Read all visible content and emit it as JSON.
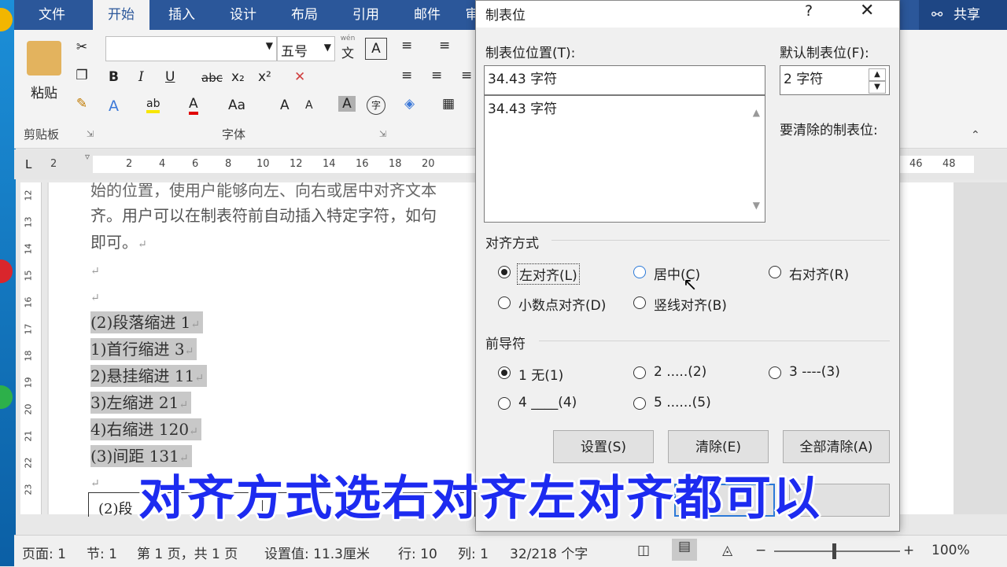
{
  "ribbon": {
    "tabs": [
      "文件",
      "开始",
      "插入",
      "设计",
      "布局",
      "引用",
      "邮件",
      "审"
    ],
    "active_tab": "开始",
    "share": "共享",
    "paste": "粘贴",
    "font_size": "五号",
    "clipboard_group": "剪贴板",
    "font_group": "字体",
    "wen": "wén",
    "wen_char": "文",
    "bold": "B",
    "italic": "I",
    "underline": "U",
    "strike": "abc",
    "subscript": "x₂",
    "superscript": "x²",
    "font_color": "A",
    "highlight": "ab",
    "change_case": "Aa",
    "grow": "A",
    "shrink": "A",
    "char_shade": "A",
    "enclose": "字"
  },
  "ruler": {
    "tab_selector": "L",
    "marks": [
      "2",
      "2",
      "4",
      "6",
      "8",
      "10",
      "12",
      "14",
      "16",
      "18",
      "20",
      "46",
      "48"
    ]
  },
  "vruler": [
    "12",
    "13",
    "14",
    "15",
    "16",
    "17",
    "18",
    "19",
    "20",
    "21",
    "22",
    "23"
  ],
  "document": {
    "line1": "始的位置，使用户能够向左、向右或居中对齐文本",
    "line2": "齐。用户可以在制表符前自动插入特定字符，如句",
    "line3": "即可。",
    "items": [
      "(2)段落缩进 1",
      "1)首行缩进 3",
      "2)悬挂缩进 11",
      "3)左缩进 21",
      "4)右缩进 120",
      "(3)间距 131"
    ],
    "table_cell": "(2)段"
  },
  "status": {
    "page": "页面: 1",
    "section": "节: 1",
    "pages": "第 1 页，共 1 页",
    "setting": "设置值: 11.3厘米",
    "row": "行: 10",
    "col": "列: 1",
    "words": "32/218 个字",
    "zoom": "100%",
    "minus": "−",
    "plus": "+"
  },
  "dialog": {
    "title": "制表位",
    "help": "?",
    "close": "✕",
    "position_label": "制表位位置(T):",
    "position_value": "34.43 字符",
    "list_items": [
      "34.43 字符"
    ],
    "default_label": "默认制表位(F):",
    "default_value": "2 字符",
    "clear_label": "要清除的制表位:",
    "align_group": "对齐方式",
    "align_options": [
      "左对齐(L)",
      "居中(C)",
      "右对齐(R)",
      "小数点对齐(D)",
      "竖线对齐(B)"
    ],
    "leader_group": "前导符",
    "leader_options": [
      "1 无(1)",
      "2 .....(2)",
      "3 ----(3)",
      "4 ____(4)",
      "5 ......(5)"
    ],
    "buttons": {
      "set": "设置(S)",
      "clear": "清除(E)",
      "clear_all": "全部清除(A)"
    }
  },
  "subtitle": "对齐方式选右对齐左对齐都可以"
}
